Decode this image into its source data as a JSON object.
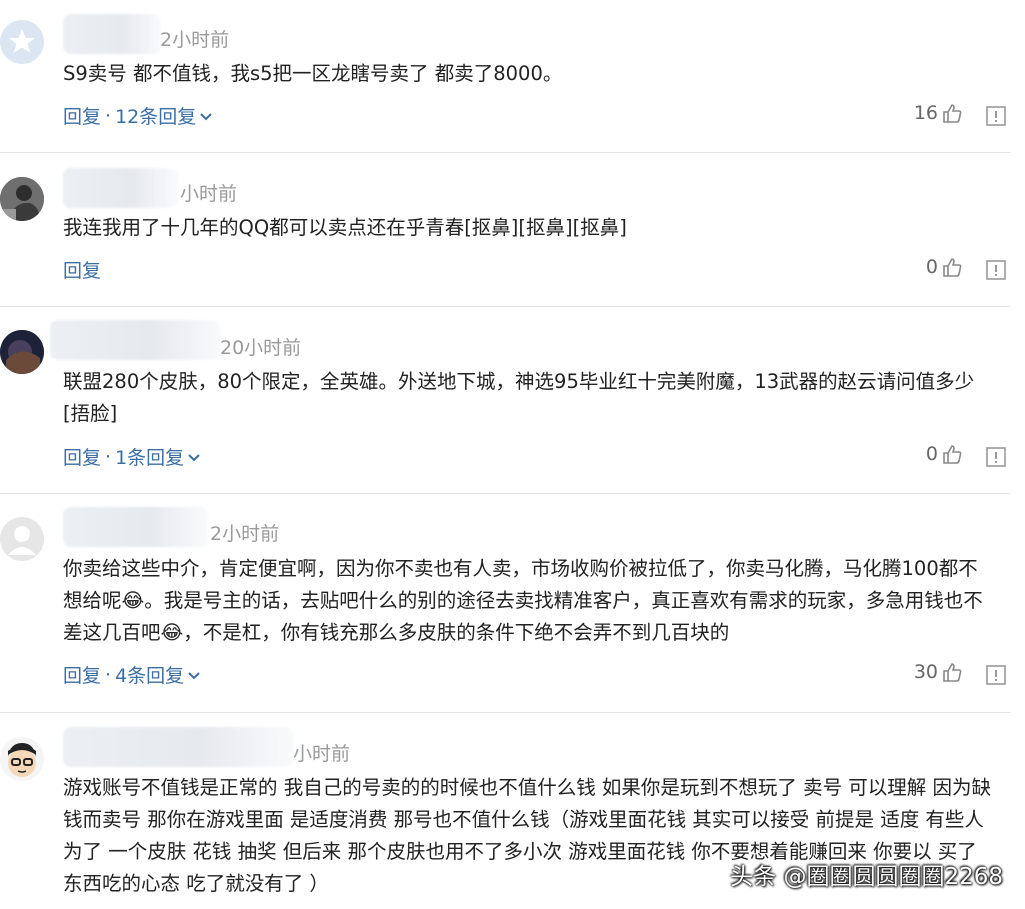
{
  "comments": [
    {
      "time": "2小时前",
      "text": "S9卖号 都不值钱，我s5把一区龙瞎号卖了 都卖了8000。",
      "reply_label": "回复",
      "reply_count": "12条回复",
      "likes": "16"
    },
    {
      "time": "小时前",
      "text": "我连我用了十几年的QQ都可以卖点还在乎青春[抠鼻][抠鼻][抠鼻]",
      "reply_label": "回复",
      "reply_count": "",
      "likes": "0"
    },
    {
      "time": "20小时前",
      "text": "联盟280个皮肤，80个限定，全英雄。外送地下城，神选95毕业红十完美附魔，13武器的赵云请问值多少[捂脸]",
      "reply_label": "回复",
      "reply_count": "1条回复",
      "likes": "0"
    },
    {
      "time": "2小时前",
      "text": "你卖给这些中介，肯定便宜啊，因为你不卖也有人卖，市场收购价被拉低了，你卖马化腾，马化腾100都不想给呢😂。我是号主的话，去贴吧什么的别的途径去卖找精准客户，真正喜欢有需求的玩家，多急用钱也不差这几百吧😂，不是杠，你有钱充那么多皮肤的条件下绝不会弄不到几百块的",
      "reply_label": "回复",
      "reply_count": "4条回复",
      "likes": "30"
    },
    {
      "time": "小时前",
      "text": "游戏账号不值钱是正常的 我自己的号卖的的时候也不值什么钱 如果你是玩到不想玩了 卖号 可以理解 因为缺钱而卖号 那你在游戏里面 是适度消费 那号也不值什么钱（游戏里面花钱 其实可以接受 前提是 适度 有些人为了 一个皮肤 花钱 抽奖 但后来 那个皮肤也用不了多小次 游戏里面花钱 你不要想着能赚回来 你要以 买了东西吃的心态 吃了就没有了 ）",
      "reply_label": "",
      "reply_count": "",
      "likes": ""
    }
  ],
  "watermark": "头条 @圈圈圆圆圈圈2268",
  "colors": {
    "link": "#3b6ea5",
    "time": "#9a9a9a",
    "text": "#222222"
  }
}
